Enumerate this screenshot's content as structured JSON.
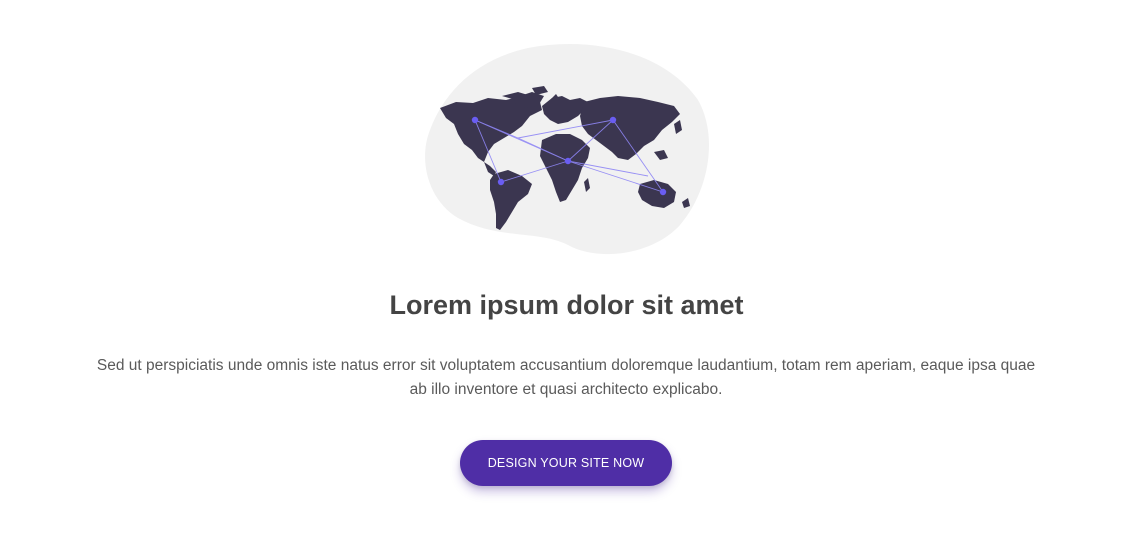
{
  "illustration": {
    "icon": "world-map-icon",
    "blob_color": "#f1f1f1",
    "land_color": "#3b3650",
    "node_color": "#6a5df2",
    "link_color": "#8f86f5"
  },
  "hero": {
    "title": "Lorem ipsum dolor sit amet",
    "description": "Sed ut perspiciatis unde omnis iste natus error sit voluptatem accusantium doloremque laudantium, totam rem aperiam, eaque ipsa quae ab illo inventore et quasi architecto explicabo.",
    "cta_label": "DESIGN YOUR SITE NOW"
  },
  "colors": {
    "accent": "#4f2ea6",
    "title_text": "#444444",
    "body_text": "#5a5a5a",
    "background": "#ffffff"
  }
}
